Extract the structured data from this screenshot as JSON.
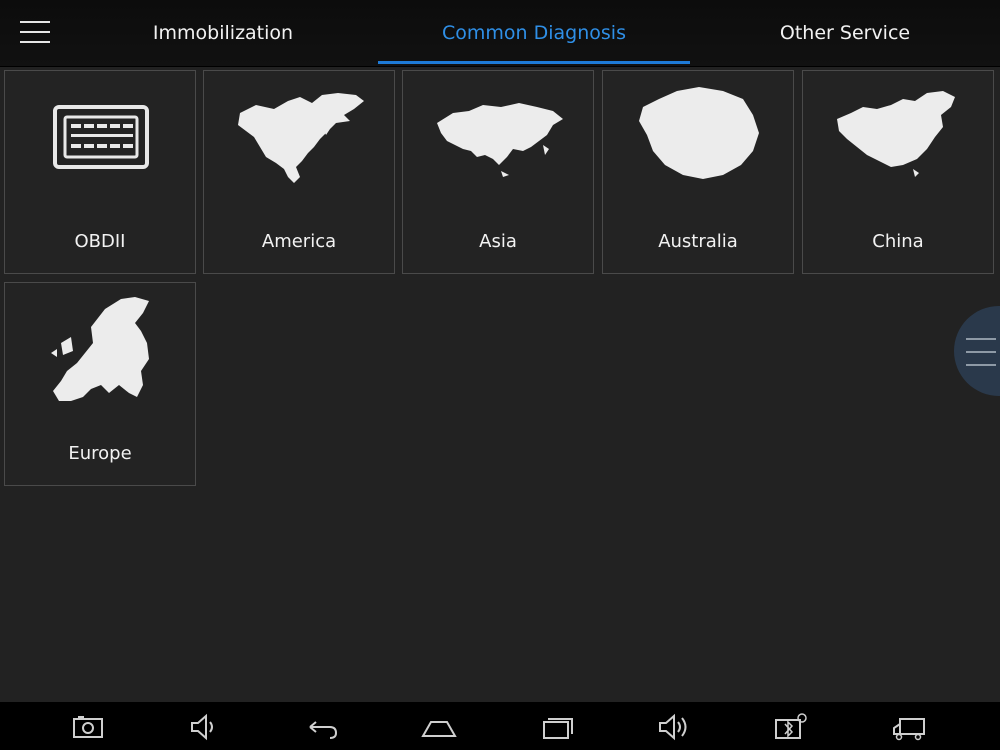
{
  "header": {
    "menu_icon": "hamburger-menu-icon",
    "tabs": [
      {
        "label": "Immobilization",
        "active": false
      },
      {
        "label": "Common Diagnosis",
        "active": true
      },
      {
        "label": "Other Service",
        "active": false
      }
    ],
    "active_color": "#2f8fe6"
  },
  "tiles": [
    {
      "label": "OBDII",
      "icon": "obd-connector-icon"
    },
    {
      "label": "America",
      "icon": "north-america-map-icon"
    },
    {
      "label": "Asia",
      "icon": "asia-map-icon"
    },
    {
      "label": "Australia",
      "icon": "australia-map-icon"
    },
    {
      "label": "China",
      "icon": "china-map-icon"
    },
    {
      "label": "Europe",
      "icon": "europe-map-icon"
    }
  ],
  "side_handle": {
    "icon": "floating-menu-icon"
  },
  "navbar": {
    "icons": [
      "screenshot-icon",
      "volume-down-icon",
      "back-icon",
      "home-icon",
      "recent-apps-icon",
      "volume-up-icon",
      "vci-bluetooth-icon",
      "truck-icon"
    ]
  }
}
